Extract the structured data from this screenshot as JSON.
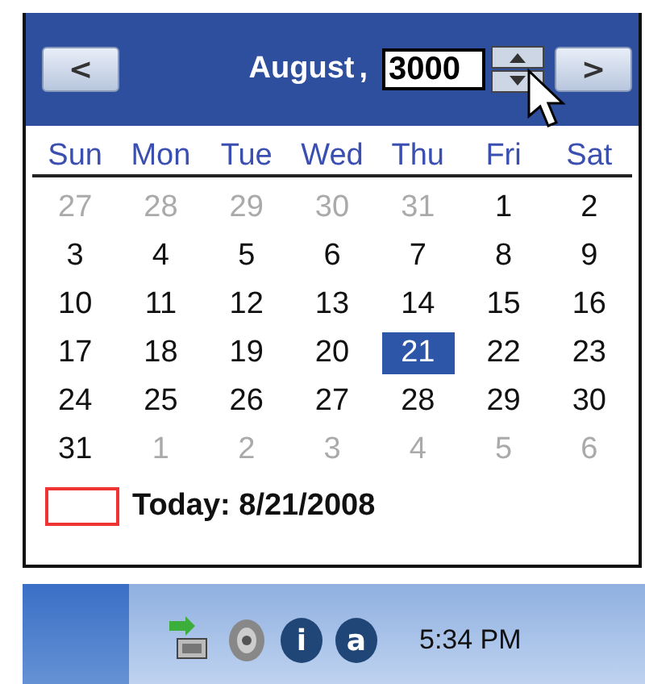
{
  "calendar": {
    "prev": "<",
    "month": "August",
    "separator": ",",
    "year": "3000",
    "next": ">",
    "weekdays": [
      "Sun",
      "Mon",
      "Tue",
      "Wed",
      "Thu",
      "Fri",
      "Sat"
    ],
    "weeks": [
      [
        {
          "day": "27",
          "other_month": true,
          "selected": false
        },
        {
          "day": "28",
          "other_month": true,
          "selected": false
        },
        {
          "day": "29",
          "other_month": true,
          "selected": false
        },
        {
          "day": "30",
          "other_month": true,
          "selected": false
        },
        {
          "day": "31",
          "other_month": true,
          "selected": false
        },
        {
          "day": "1",
          "other_month": false,
          "selected": false
        },
        {
          "day": "2",
          "other_month": false,
          "selected": false
        }
      ],
      [
        {
          "day": "3",
          "other_month": false,
          "selected": false
        },
        {
          "day": "4",
          "other_month": false,
          "selected": false
        },
        {
          "day": "5",
          "other_month": false,
          "selected": false
        },
        {
          "day": "6",
          "other_month": false,
          "selected": false
        },
        {
          "day": "7",
          "other_month": false,
          "selected": false
        },
        {
          "day": "8",
          "other_month": false,
          "selected": false
        },
        {
          "day": "9",
          "other_month": false,
          "selected": false
        }
      ],
      [
        {
          "day": "10",
          "other_month": false,
          "selected": false
        },
        {
          "day": "11",
          "other_month": false,
          "selected": false
        },
        {
          "day": "12",
          "other_month": false,
          "selected": false
        },
        {
          "day": "13",
          "other_month": false,
          "selected": false
        },
        {
          "day": "14",
          "other_month": false,
          "selected": false
        },
        {
          "day": "15",
          "other_month": false,
          "selected": false
        },
        {
          "day": "16",
          "other_month": false,
          "selected": false
        }
      ],
      [
        {
          "day": "17",
          "other_month": false,
          "selected": false
        },
        {
          "day": "18",
          "other_month": false,
          "selected": false
        },
        {
          "day": "19",
          "other_month": false,
          "selected": false
        },
        {
          "day": "20",
          "other_month": false,
          "selected": false
        },
        {
          "day": "21",
          "other_month": false,
          "selected": true
        },
        {
          "day": "22",
          "other_month": false,
          "selected": false
        },
        {
          "day": "23",
          "other_month": false,
          "selected": false
        }
      ],
      [
        {
          "day": "24",
          "other_month": false,
          "selected": false
        },
        {
          "day": "25",
          "other_month": false,
          "selected": false
        },
        {
          "day": "26",
          "other_month": false,
          "selected": false
        },
        {
          "day": "27",
          "other_month": false,
          "selected": false
        },
        {
          "day": "28",
          "other_month": false,
          "selected": false
        },
        {
          "day": "29",
          "other_month": false,
          "selected": false
        },
        {
          "day": "30",
          "other_month": false,
          "selected": false
        }
      ],
      [
        {
          "day": "31",
          "other_month": false,
          "selected": false
        },
        {
          "day": "1",
          "other_month": true,
          "selected": false
        },
        {
          "day": "2",
          "other_month": true,
          "selected": false
        },
        {
          "day": "3",
          "other_month": true,
          "selected": false
        },
        {
          "day": "4",
          "other_month": true,
          "selected": false
        },
        {
          "day": "5",
          "other_month": true,
          "selected": false
        },
        {
          "day": "6",
          "other_month": true,
          "selected": false
        }
      ]
    ],
    "today": "Today: 8/21/2008"
  },
  "taskbar": {
    "tray_icons": [
      {
        "kind": "network"
      },
      {
        "kind": "volume"
      },
      {
        "kind": "badge",
        "text": "i"
      },
      {
        "kind": "badge",
        "text": "a"
      }
    ],
    "clock": "5:34 PM"
  }
}
